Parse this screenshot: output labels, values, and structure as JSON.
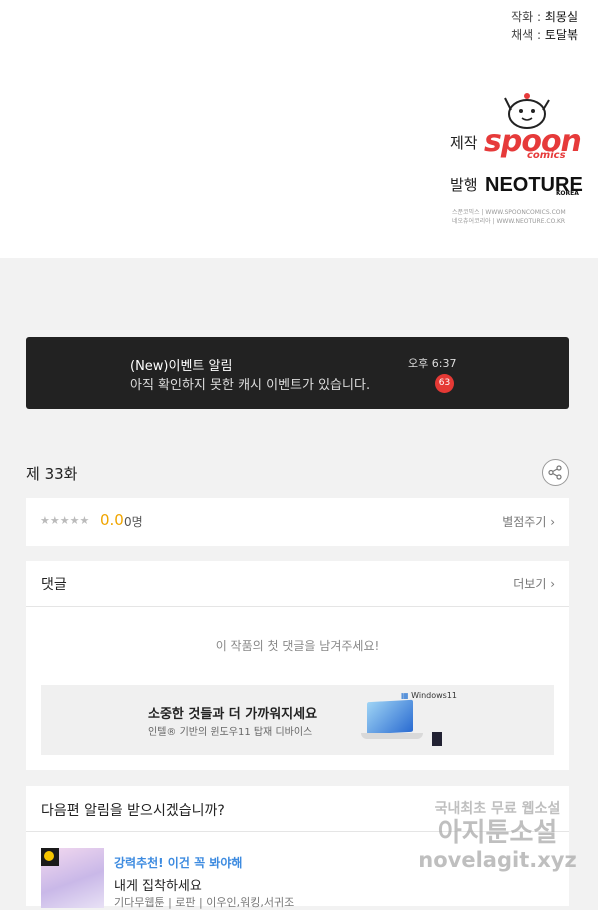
{
  "credits": [
    {
      "role": "작화 :",
      "name": "최몽실"
    },
    {
      "role": "채색 :",
      "name": "토달볶"
    }
  ],
  "production": {
    "made_by_label": "제작",
    "publisher_label": "발행",
    "spoon_logo_text": "spoon",
    "spoon_logo_sub": "comics",
    "neoture_logo_text": "NEOTURE",
    "neoture_logo_sub": "KOREA",
    "url_line_1": "스푼코믹스 | WWW.SPOONCOMICS.COM",
    "url_line_2": "네오츄어코리아 | WWW.NEOTURE.CO.KR"
  },
  "notification": {
    "title": "(New)이벤트 알림",
    "body": "아직 확인하지 못한 캐시 이벤트가 있습니다.",
    "time": "오후 6:37",
    "badge": "63"
  },
  "episode": {
    "title": "제 33화",
    "share_icon": "share-icon"
  },
  "rating": {
    "stars_text": "★★★★★",
    "value": "0.0",
    "count": "0명",
    "rate_link": "별점주기 ›"
  },
  "comments": {
    "heading": "댓글",
    "more_link": "더보기 ›",
    "empty_message": "이 작품의 첫 댓글을 남겨주세요!"
  },
  "ad": {
    "title": "소중한 것들과 더 가까워지세요",
    "subtitle": "인텔® 기반의 윈도우11 탑재 디바이스",
    "badge": "Windows11"
  },
  "next_notify": {
    "heading": "다음편 알림을 받으시겠습니까?"
  },
  "recommendation": {
    "title": "강력추천! 이건 꼭 봐야해",
    "subtitle": "내게 집착하세요",
    "meta": "기다무웹툰 | 로판 | 이우인,워킹,서귀조"
  },
  "watermark": {
    "line_1": "국내최초 무료 웹소설",
    "line_2": "아지툰소설",
    "line_3": "novelagit.xyz"
  },
  "colors": {
    "accent_red": "#e53935",
    "rating_yellow": "#f0a500",
    "link_blue": "#3d8be0",
    "spoon_red": "#e63a3a"
  }
}
